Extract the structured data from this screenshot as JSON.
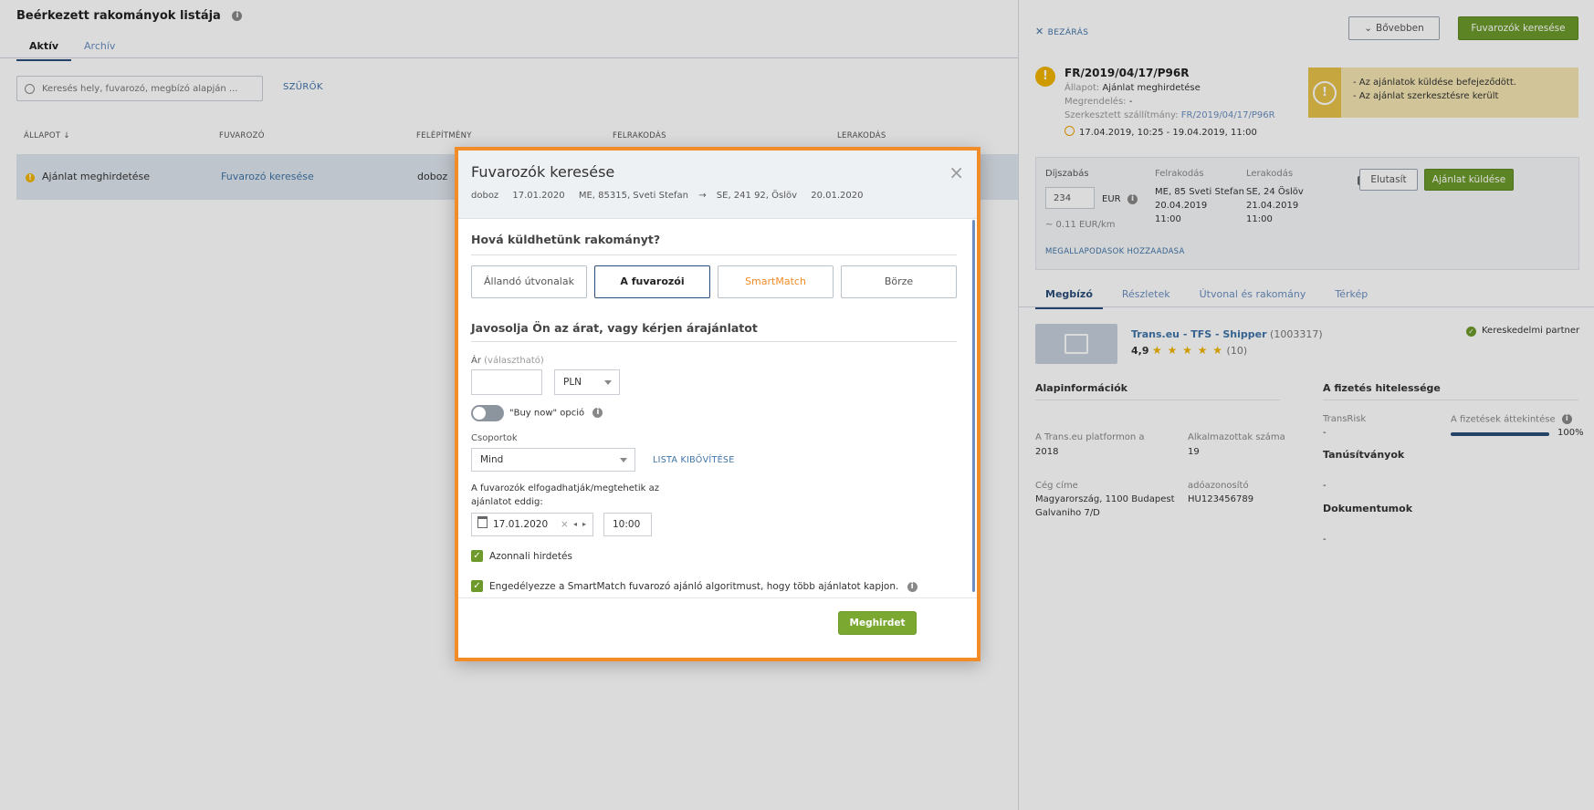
{
  "list": {
    "title": "Beérkezett rakományok listája",
    "tabs": [
      "Aktív",
      "Archív"
    ],
    "search_placeholder": "Keresés hely, fuvarozó, megbízó alapján ...",
    "filters_label": "SZŰRŐK",
    "columns": [
      "ÁLLAPOT ↓",
      "FUVAROZÓ",
      "FELÉPÍTMÉNY",
      "FELRAKODÁS",
      "LERAKODÁS"
    ],
    "row": {
      "status": "Ajánlat meghirdetése",
      "carrier": "Fuvarozó keresése",
      "body": "doboz"
    }
  },
  "detail": {
    "close_label": "BEZÁRÁS",
    "more_label": "Bővebben",
    "search_carriers_label": "Fuvarozók keresése",
    "order_no": "FR/2019/04/17/P96R",
    "status_label": "Állapot:",
    "status_value": "Ajánlat meghirdetése",
    "order_label": "Megrendelés:",
    "order_value": "-",
    "edited_label": "Szerkesztett szállítmány:",
    "edited_value": "FR/2019/04/17/P96R",
    "date_range": "17.04.2019, 10:25 - 19.04.2019, 11:00",
    "alert_lines": [
      "- Az ajánlatok küldése befejeződött.",
      "- Az ajánlat szerkesztésre került"
    ],
    "pricing": {
      "label": "Díjszabás",
      "price": "234",
      "currency": "EUR",
      "per_km": "~ 0.11  EUR/km",
      "loading_label": "Felrakodás",
      "loading_place": "ME, 85 Sveti Stefan",
      "loading_date": "20.04.2019",
      "loading_time": "11:00",
      "unloading_label": "Lerakodás",
      "unloading_place": "SE, 24 Öslöv",
      "unloading_date": "21.04.2019",
      "unloading_time": "11:00",
      "reject_label": "Elutasít",
      "send_label": "Ajánlat küldése",
      "add_agreements": "MEGALLAPODASOK HOZZAADASA"
    },
    "tabs": [
      "Megbízó",
      "Részletek",
      "Útvonal és rakomány",
      "Térkép"
    ],
    "company": {
      "name": "Trans.eu - TFS - Shipper",
      "id": "(1003317)",
      "rating": "4,9",
      "stars": "★ ★ ★ ★ ★",
      "reviews": "(10)",
      "partner": "Kereskedelmi partner"
    },
    "basic_title": "Alapinformációk",
    "platform_label": "A Trans.eu platformon a",
    "platform_value": "2018",
    "employees_label": "Alkalmazottak száma",
    "employees_value": "19",
    "address_label": "Cég címe",
    "address_line1": "Magyarország, 1100 Budapest",
    "address_line2": "Galvaniho 7/D",
    "tax_label": "adóazonosító",
    "tax_value": "HU123456789",
    "payment_title": "A fizetés hitelessége",
    "transrisk_label": "TransRisk",
    "transrisk_value": "-",
    "overview_label": "A fizetések áttekintése",
    "overview_value": "100%",
    "overview_fill": 1.0,
    "certs_title": "Tanúsítványok",
    "certs_value": "-",
    "docs_title": "Dokumentumok",
    "docs_value": "-"
  },
  "modal": {
    "title": "Fuvarozók keresése",
    "sub_body": "doboz",
    "sub_date1": "17.01.2020",
    "sub_from": "ME, 85315, Sveti Stefan",
    "sub_arrow": "→",
    "sub_to": "SE, 241 92, Öslöv",
    "sub_date2": "20.01.2020",
    "close": "×",
    "q1": "Hová küldhetünk rakományt?",
    "options": [
      "Állandó útvonalak",
      "A fuvarozói",
      "SmartMatch",
      "Börze"
    ],
    "q2": "Javosolja Ön az árat, vagy kérjen árajánlatot",
    "price_label": "Ár",
    "price_optional": "(választható)",
    "price_value": "",
    "currency": "PLN",
    "buy_now": "\"Buy now\" opció",
    "groups_label": "Csoportok",
    "groups_value": "Mind",
    "expand_list": "LISTA KIBŐVÍTÉSE",
    "deadline_label_1": "A fuvarozók elfogadhatják/megtehetik az",
    "deadline_label_2": "ajánlatot eddig:",
    "deadline_date": "17.01.2020",
    "deadline_time": "10:00",
    "instant_label": "Azonnali hirdetés",
    "smartmatch_label": "Engedélyezze a SmartMatch fuvarozó ajánló algoritmust, hogy több ajánlatot kapjon.",
    "submit": "Meghirdet"
  }
}
